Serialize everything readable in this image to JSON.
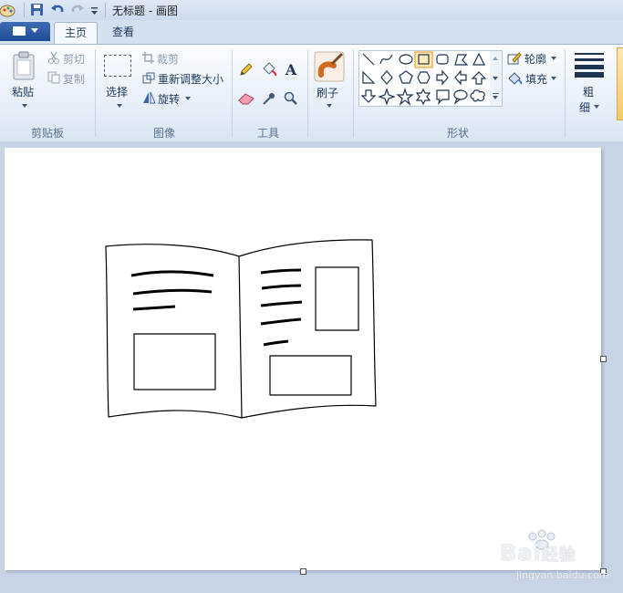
{
  "window": {
    "title": "无标题 - 画图"
  },
  "tabs": [
    {
      "label": "主页"
    },
    {
      "label": "查看"
    }
  ],
  "ribbon": {
    "clipboard": {
      "group_label": "剪贴板",
      "paste": "粘贴",
      "cut": "剪切",
      "copy": "复制"
    },
    "image": {
      "group_label": "图像",
      "select": "选择",
      "crop": "裁剪",
      "resize": "重新调整大小",
      "rotate": "旋转"
    },
    "tools": {
      "group_label": "工具",
      "text_tool_glyph": "A"
    },
    "brushes": {
      "label": "刷子"
    },
    "shapes": {
      "group_label": "形状",
      "outline": "轮廓",
      "fill": "填充"
    },
    "size": {
      "label_line1": "粗",
      "label_line2": "细"
    }
  },
  "colors": {
    "accent": "#2b5aa8",
    "selected_shape_border": "#e8a33a",
    "selected_shape_bg": "#fde9b6"
  },
  "watermark": {
    "brand": "Bai",
    "brand_suffix": "经验",
    "url": "jingyan.baidu.com"
  }
}
